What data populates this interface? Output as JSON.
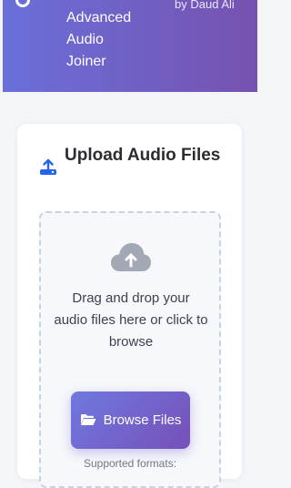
{
  "header": {
    "title_lines": [
      "Advanced",
      "Audio",
      "Joiner"
    ],
    "byline": "by Daud Ali"
  },
  "upload_card": {
    "title": "Upload Audio Files",
    "drop_text": "Drag and drop your audio files here or click to browse",
    "browse_label": "Browse Files",
    "formats_label": "Supported formats:"
  },
  "icons": {
    "header_logo": "logo-icon",
    "card_title": "upload-icon",
    "dropzone": "cloud-upload-icon",
    "browse_button": "folder-open-icon"
  },
  "colors": {
    "header_gradient": [
      "#6a6fd9",
      "#7652b0"
    ],
    "accent_blue": "#2563eb",
    "button_gradient": [
      "#6f79e0",
      "#7650b8"
    ],
    "cloud_gray": "#a3a8b5"
  }
}
